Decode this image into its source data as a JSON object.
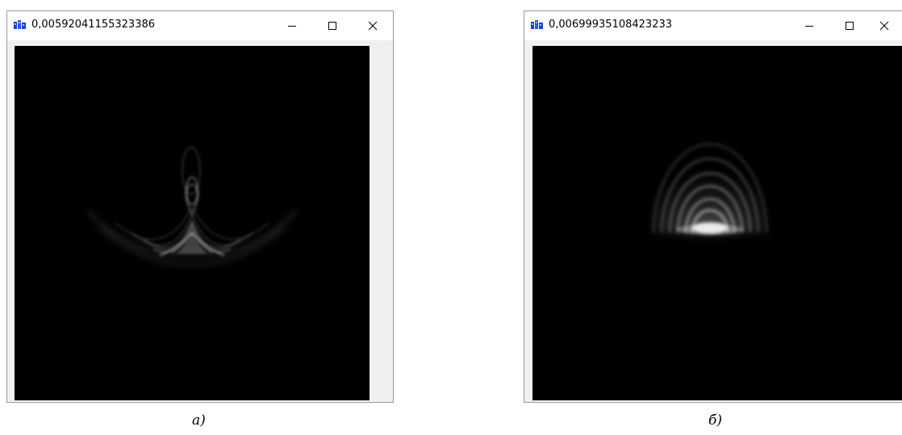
{
  "windows": [
    {
      "title": "0,00592041155323386",
      "controls": {
        "minimize": "minimize-icon",
        "maximize": "maximize-icon",
        "close": "close-icon"
      },
      "image": "interference-curves-image"
    },
    {
      "title": "0,00699935108423233",
      "controls": {
        "minimize": "minimize-icon",
        "maximize": "maximize-icon",
        "close": "close-icon"
      },
      "image": "glowing-arcs-image"
    }
  ],
  "captions": {
    "a": "а)",
    "b": "б)"
  },
  "colors": {
    "canvas_bg": "#000000",
    "window_bg": "#f0f0f0",
    "titlebar_bg": "#ffffff",
    "app_icon": "#1e3fd6"
  }
}
